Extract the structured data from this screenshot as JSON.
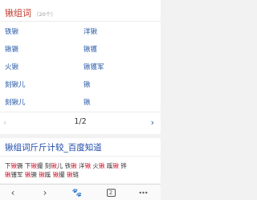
{
  "results": {
    "title": "锹组词",
    "count": "（20个）",
    "words": [
      [
        "铁锹",
        "洋锹"
      ],
      [
        "锹镢",
        "锹镬"
      ],
      [
        "火锹",
        "锹镬军"
      ],
      [
        "刻锹儿",
        "锹"
      ],
      [
        "刻锹儿",
        "锹"
      ]
    ],
    "pager": {
      "prev": "‹",
      "page": "1/2",
      "next": "›"
    }
  },
  "result2": {
    "title": "锹组词斤斤计较_百度知道",
    "snippet_line1": [
      {
        "t": "下",
        "hl": false
      },
      {
        "t": "锹",
        "hl": true
      },
      {
        "t": "镢 下",
        "hl": false
      },
      {
        "t": "锹",
        "hl": true
      },
      {
        "t": "撮 刻",
        "hl": false
      },
      {
        "t": "锹",
        "hl": true
      },
      {
        "t": "儿 铁",
        "hl": false
      },
      {
        "t": "锹",
        "hl": true
      },
      {
        "t": " 洋",
        "hl": false
      },
      {
        "t": "锹",
        "hl": true
      },
      {
        "t": " 火",
        "hl": false
      },
      {
        "t": "锹",
        "hl": true
      },
      {
        "t": " 蹊",
        "hl": false
      },
      {
        "t": "锹",
        "hl": true
      },
      {
        "t": " 铧",
        "hl": false
      }
    ],
    "snippet_line2": [
      {
        "t": "锹",
        "hl": true
      },
      {
        "t": "镬军 ",
        "hl": false
      },
      {
        "t": "锹",
        "hl": true
      },
      {
        "t": "镢 ",
        "hl": false
      },
      {
        "t": "锹",
        "hl": true
      },
      {
        "t": "蹊 ",
        "hl": false
      },
      {
        "t": "锹",
        "hl": true
      },
      {
        "t": "撮 ",
        "hl": false
      },
      {
        "t": "锹",
        "hl": true
      },
      {
        "t": "链",
        "hl": false
      }
    ]
  },
  "toolbar": {
    "back": "‹",
    "forward": "›",
    "paw": "🐾",
    "tabs_count": "2",
    "more": "•••"
  }
}
